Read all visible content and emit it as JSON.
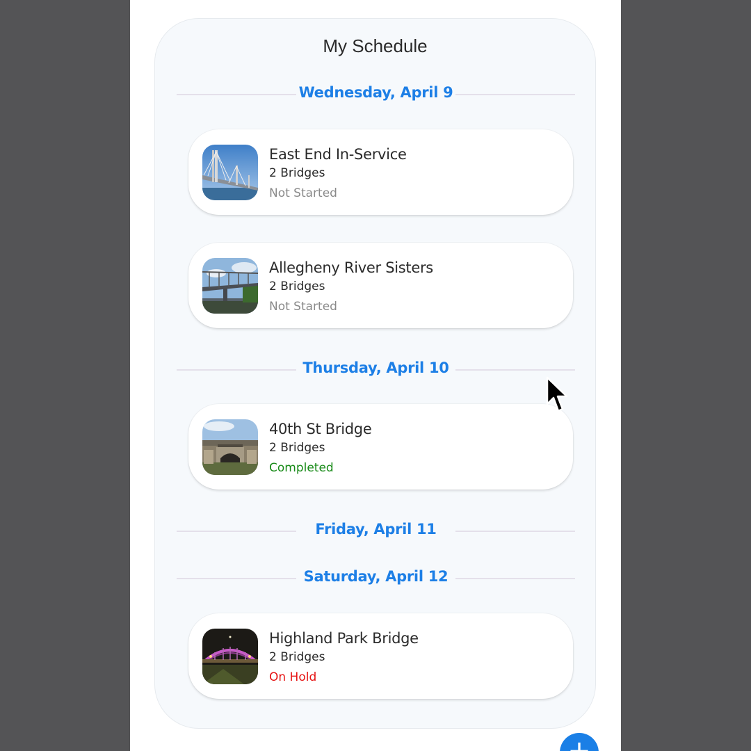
{
  "title": "My Schedule",
  "days": [
    {
      "label": "Wednesday, April 9",
      "entries": [
        {
          "title": "East End In-Service",
          "subtitle": "2 Bridges",
          "status": "Not Started",
          "status_color": "#8a8a8a",
          "thumb_icon": "cable-stayed-bridge-photo"
        },
        {
          "title": "Allegheny River Sisters",
          "subtitle": "2 Bridges",
          "status": "Not Started",
          "status_color": "#8a8a8a",
          "thumb_icon": "truss-bridge-photo"
        }
      ]
    },
    {
      "label": "Thursday, April 10",
      "entries": [
        {
          "title": "40th St Bridge",
          "subtitle": "2 Bridges",
          "status": "Completed",
          "status_color": "#178a17",
          "thumb_icon": "stone-arch-bridge-photo"
        }
      ]
    },
    {
      "label": "Friday, April 11",
      "entries": []
    },
    {
      "label": "Saturday, April 12",
      "entries": [
        {
          "title": "Highland Park Bridge",
          "subtitle": "2 Bridges",
          "status": "On Hold",
          "status_color": "#e61414",
          "thumb_icon": "night-arch-bridge-photo"
        }
      ]
    }
  ],
  "fab": {
    "label": "+",
    "icon": "plus-icon",
    "color": "#1a7fe6"
  },
  "accent_color": "#1d7fe6"
}
